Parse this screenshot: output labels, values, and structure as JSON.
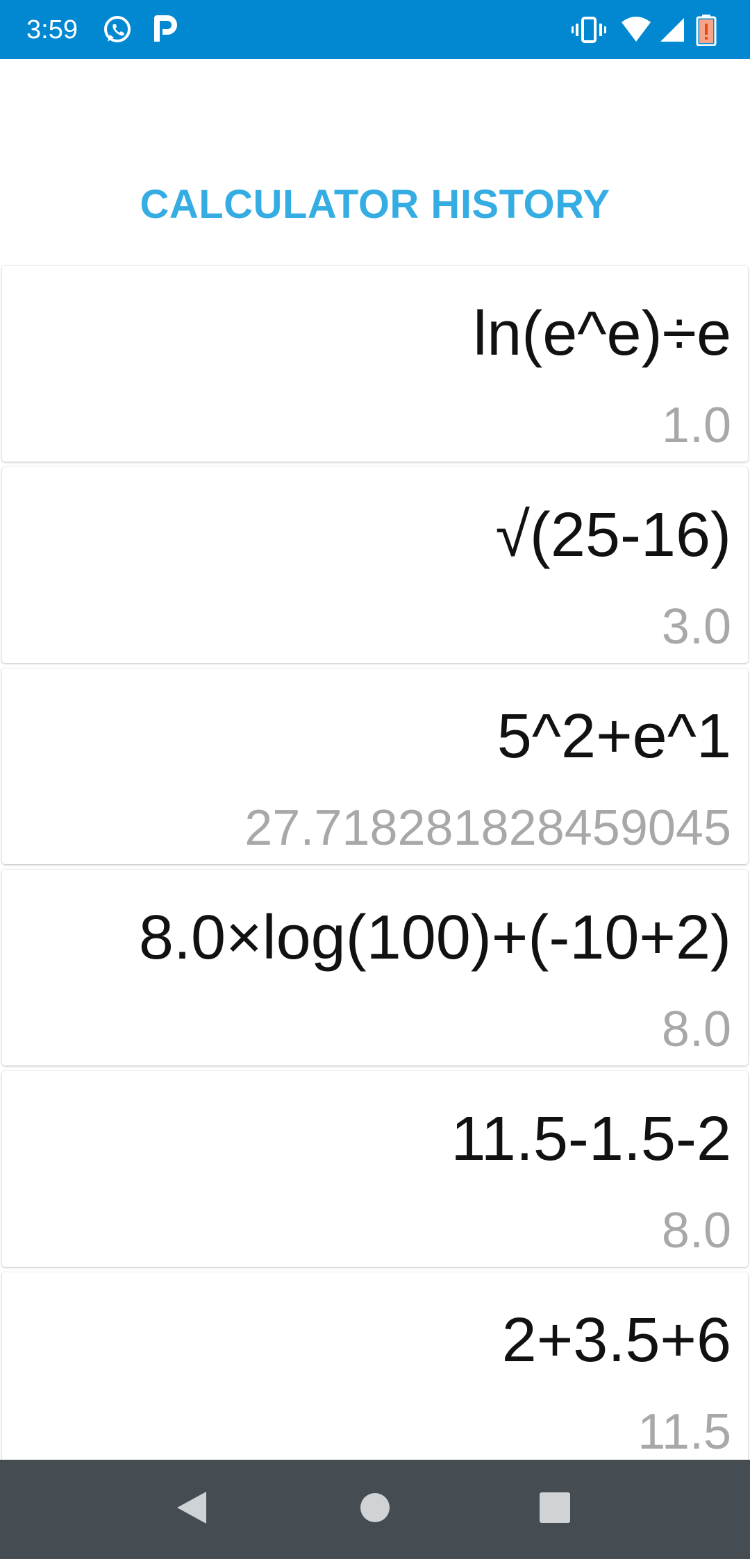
{
  "status_bar": {
    "time": "3:59",
    "left_icons": [
      "whatsapp-icon",
      "parking-p-icon"
    ],
    "right_icons": [
      "vibrate-icon",
      "wifi-icon",
      "signal-icon",
      "battery-low-icon"
    ],
    "background_color": "#0288d1"
  },
  "header": {
    "title": "CALCULATOR HISTORY",
    "title_color": "#35ade3"
  },
  "history": [
    {
      "expression": "ln(e^e)÷e",
      "result": "1.0"
    },
    {
      "expression": "√(25-16)",
      "result": "3.0"
    },
    {
      "expression": "5^2+e^1",
      "result": "27.718281828459045"
    },
    {
      "expression": "8.0×log(100)+(-10+2)",
      "result": "8.0"
    },
    {
      "expression": "11.5-1.5-2",
      "result": "8.0"
    },
    {
      "expression": "2+3.5+6",
      "result": "11.5"
    }
  ],
  "nav_bar": {
    "buttons": [
      "back-icon",
      "home-icon",
      "recents-icon"
    ],
    "background_color": "#454c52"
  }
}
